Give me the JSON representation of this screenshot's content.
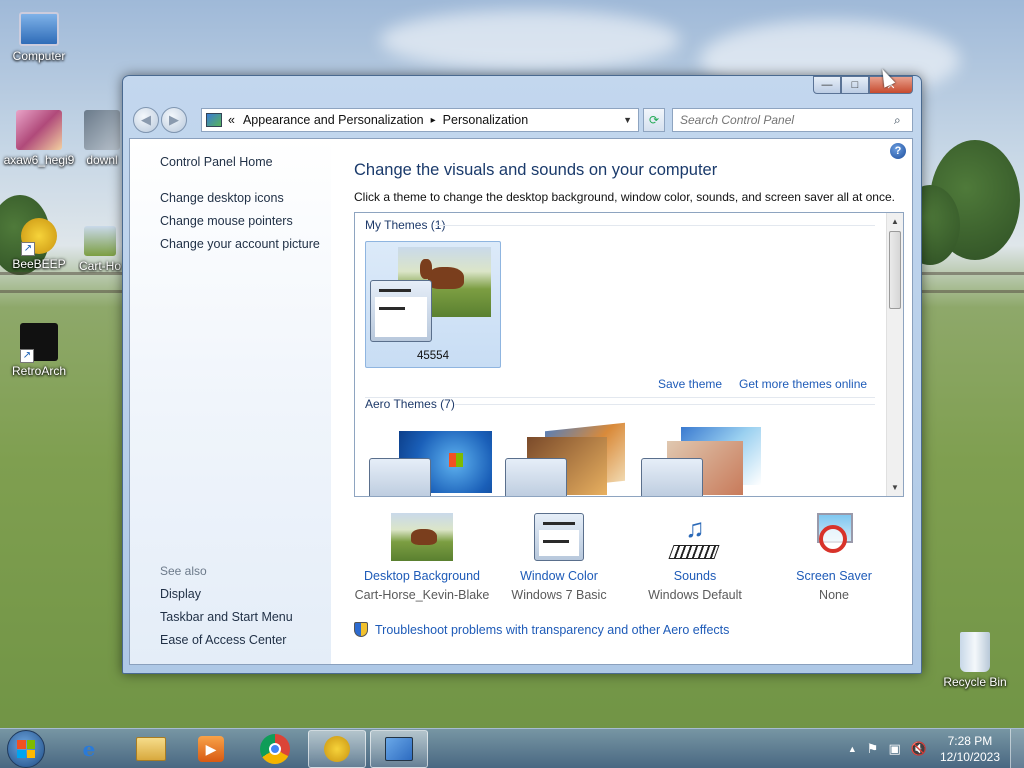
{
  "desktop": {
    "icons": [
      {
        "label": "Computer"
      },
      {
        "label": "axaw6_hegi9"
      },
      {
        "label": "downl"
      },
      {
        "label": "BeeBEEP"
      },
      {
        "label": "Cart-Ho"
      },
      {
        "label": "RetroArch"
      },
      {
        "label": "Recycle Bin"
      }
    ]
  },
  "window": {
    "buttons": {
      "minimize": "—",
      "maximize": "□",
      "close": "✕"
    },
    "nav": {
      "back_icon": "◀",
      "forward_icon": "▶"
    },
    "address": {
      "prefix": "«",
      "crumbs": [
        "Appearance and Personalization",
        "Personalization"
      ],
      "separator": "▸",
      "dropdown": "▼"
    },
    "search": {
      "placeholder": "Search Control Panel"
    }
  },
  "left_pane": {
    "home": "Control Panel Home",
    "links": [
      "Change desktop icons",
      "Change mouse pointers",
      "Change your account picture"
    ],
    "see_also_label": "See also",
    "see_also": [
      "Display",
      "Taskbar and Start Menu",
      "Ease of Access Center"
    ]
  },
  "main": {
    "help": "?",
    "title": "Change the visuals and sounds on your computer",
    "subtitle": "Click a theme to change the desktop background, window color, sounds, and screen saver all at once.",
    "my_themes_header": "My Themes (1)",
    "my_theme_name": "45554",
    "save_theme": "Save theme",
    "get_more": "Get more themes online",
    "aero_header": "Aero Themes (7)",
    "bottom": [
      {
        "label": "Desktop Background",
        "value": "Cart-Horse_Kevin-Blake"
      },
      {
        "label": "Window Color",
        "value": "Windows 7 Basic"
      },
      {
        "label": "Sounds",
        "value": "Windows Default"
      },
      {
        "label": "Screen Saver",
        "value": "None"
      }
    ],
    "troubleshoot": "Troubleshoot problems with transparency and other Aero effects"
  },
  "taskbar": {
    "time": "7:28 PM",
    "date": "12/10/2023",
    "tray_up": "▲"
  }
}
